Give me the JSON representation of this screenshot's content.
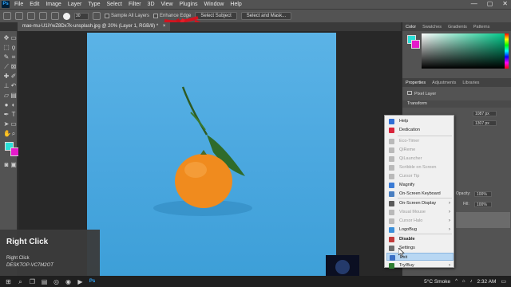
{
  "menubar": {
    "app_logo": "Ps",
    "items": [
      "File",
      "Edit",
      "Image",
      "Layer",
      "Type",
      "Select",
      "Filter",
      "3D",
      "View",
      "Plugins",
      "Window",
      "Help"
    ],
    "window_controls": {
      "minimize": "—",
      "maximize": "▢",
      "close": "✕"
    }
  },
  "options_bar": {
    "brush_size": "30",
    "sample_all_layers": "Sample All Layers",
    "enhance_edge": "Enhance Edge",
    "select_subject": "Select Subject",
    "select_and_mask": "Select and Mask..."
  },
  "document_tab": {
    "title": "mae-mu-U1iYwZ8Dx7k-unsplash.jpg @ 20% (Layer 1, RGB/8) *",
    "close": "×"
  },
  "color_panel": {
    "tabs": [
      "Color",
      "Swatches",
      "Gradients",
      "Patterns"
    ],
    "foreground_color": "#2be0d8",
    "background_color": "#e61acb"
  },
  "properties_panel": {
    "tabs": [
      "Properties",
      "Adjustments",
      "Libraries"
    ],
    "layer_type": "Pixel Layer",
    "section": "Transform",
    "w_value": "1087 px",
    "h_value": "1307 px",
    "opacity_label": "Opacity:",
    "opacity_value": "100%",
    "fill_label": "Fill:",
    "fill_value": "100%"
  },
  "context_menu": {
    "items": [
      {
        "label": "Help",
        "state": "normal",
        "icon": "help-icon",
        "color": "#2f6fd6"
      },
      {
        "label": "Dedication",
        "state": "normal",
        "icon": "heart-icon",
        "color": "#d9243a"
      },
      {
        "label": "Eco-Timer",
        "state": "disabled",
        "icon": "timer-icon",
        "color": "#b9b9b9"
      },
      {
        "label": "QiReme",
        "state": "disabled",
        "icon": "qireme-icon",
        "color": "#b9b9b9"
      },
      {
        "label": "QiLauncher",
        "state": "disabled",
        "icon": "launcher-icon",
        "color": "#b9b9b9"
      },
      {
        "label": "Scribble on Screen",
        "state": "disabled",
        "icon": "scribble-icon",
        "color": "#b9b9b9"
      },
      {
        "label": "Cursor Tip",
        "state": "disabled",
        "icon": "cursor-tip-icon",
        "color": "#b9b9b9"
      },
      {
        "label": "Magnify",
        "state": "normal",
        "icon": "magnify-icon",
        "color": "#3a7bd5"
      },
      {
        "label": "On-Screen Keyboard",
        "state": "normal",
        "icon": "keyboard-icon",
        "color": "#4a7fc1"
      },
      {
        "label": "On-Screen Display",
        "state": "normal",
        "icon": "display-icon",
        "color": "#5a5a5a",
        "submenu": true
      },
      {
        "label": "Visual Mouse",
        "state": "disabled",
        "icon": "mouse-icon",
        "color": "#b9b9b9",
        "submenu": true
      },
      {
        "label": "Cursor Halo",
        "state": "disabled",
        "icon": "halo-icon",
        "color": "#b9b9b9",
        "submenu": true
      },
      {
        "label": "LogoBug",
        "state": "normal",
        "icon": "logobug-icon",
        "color": "#3b8fd9",
        "submenu": true
      },
      {
        "label": "Disable",
        "state": "bold",
        "icon": "disable-icon",
        "color": "#c23a3a"
      },
      {
        "label": "Settings",
        "state": "normal",
        "icon": "settings-icon",
        "color": "#6d6d6d"
      },
      {
        "label": "Exit",
        "state": "highlighted",
        "icon": "exit-icon",
        "color": "#3a6fc4"
      },
      {
        "label": "Try/Buy",
        "state": "normal",
        "icon": "cart-icon",
        "color": "#2e7d32",
        "submenu": true
      }
    ]
  },
  "toast": {
    "title": "Right Click",
    "line1": "Right Click",
    "line2": "DESKTOP-VC7M2OT"
  },
  "taskbar": {
    "weather": "5°C  Smoke",
    "time": "2:32 AM"
  }
}
